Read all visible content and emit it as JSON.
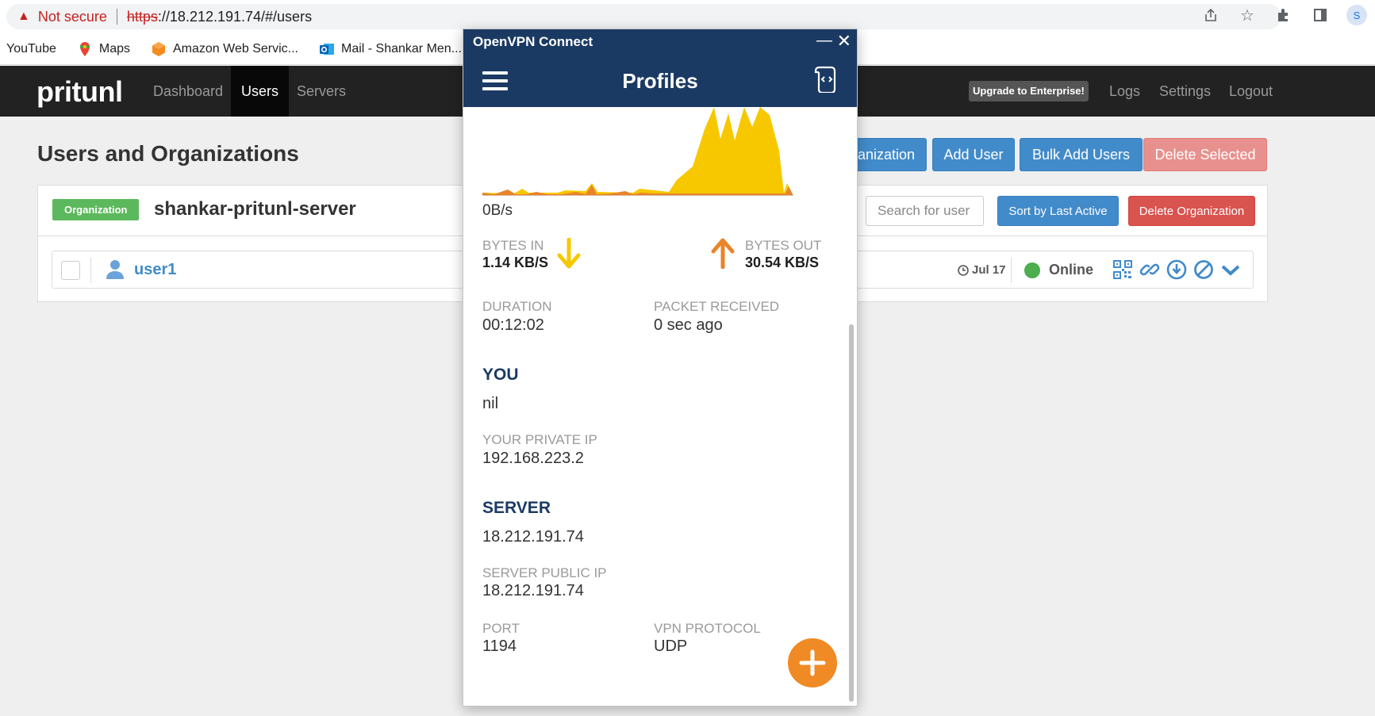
{
  "browser": {
    "security_text": "Not secure",
    "url_scheme": "https",
    "url_rest": "://18.212.191.74/#/users",
    "avatar_letter": "S",
    "bookmarks": [
      {
        "label": "YouTube",
        "icon": "none"
      },
      {
        "label": "Maps",
        "icon": "maps-icon"
      },
      {
        "label": "Amazon Web Servic...",
        "icon": "aws-icon"
      },
      {
        "label": "Mail - Shankar Men...",
        "icon": "outlook-icon"
      }
    ]
  },
  "navbar": {
    "brand": "pritunl",
    "links": [
      "Dashboard",
      "Users",
      "Servers"
    ],
    "active": "Users",
    "upgrade": "Upgrade to Enterprise!",
    "right_links": [
      "Logs",
      "Settings",
      "Logout"
    ]
  },
  "page": {
    "title": "Users and Organizations",
    "buttons": {
      "add_org": "Add Organization",
      "add_org_visible": "anization",
      "add_user": "Add User",
      "bulk_add": "Bulk Add Users",
      "delete_selected": "Delete Selected"
    }
  },
  "organization": {
    "label": "Organization",
    "name": "shankar-pritunl-server",
    "search_placeholder": "Search for user",
    "sort_button": "Sort by Last Active",
    "delete_button": "Delete Organization",
    "users": [
      {
        "name": "user1",
        "last_active": "Jul 17",
        "status": "Online"
      }
    ]
  },
  "openvpn": {
    "window_title": "OpenVPN Connect",
    "header_title": "Profiles",
    "graph_rate": "0B/s",
    "bytes_in_label": "BYTES IN",
    "bytes_in_value": "1.14 KB/S",
    "bytes_out_label": "BYTES OUT",
    "bytes_out_value": "30.54 KB/S",
    "duration_label": "DURATION",
    "duration_value": "00:12:02",
    "packet_label": "PACKET RECEIVED",
    "packet_value": "0 sec ago",
    "you_section": "YOU",
    "you_value": "nil",
    "private_ip_label": "YOUR PRIVATE IP",
    "private_ip_value": "192.168.223.2",
    "server_section": "SERVER",
    "server_value": "18.212.191.74",
    "public_ip_label": "SERVER PUBLIC IP",
    "public_ip_value": "18.212.191.74",
    "port_label": "PORT",
    "port_value": "1194",
    "protocol_label": "VPN PROTOCOL",
    "protocol_value": "UDP"
  },
  "colors": {
    "pritunl_primary": "#428bca",
    "pritunl_danger": "#d9534f",
    "pritunl_success": "#5cb85c",
    "openvpn_navy": "#1b3a63",
    "openvpn_orange": "#f08a24",
    "bytes_in_yellow": "#f7c800"
  }
}
